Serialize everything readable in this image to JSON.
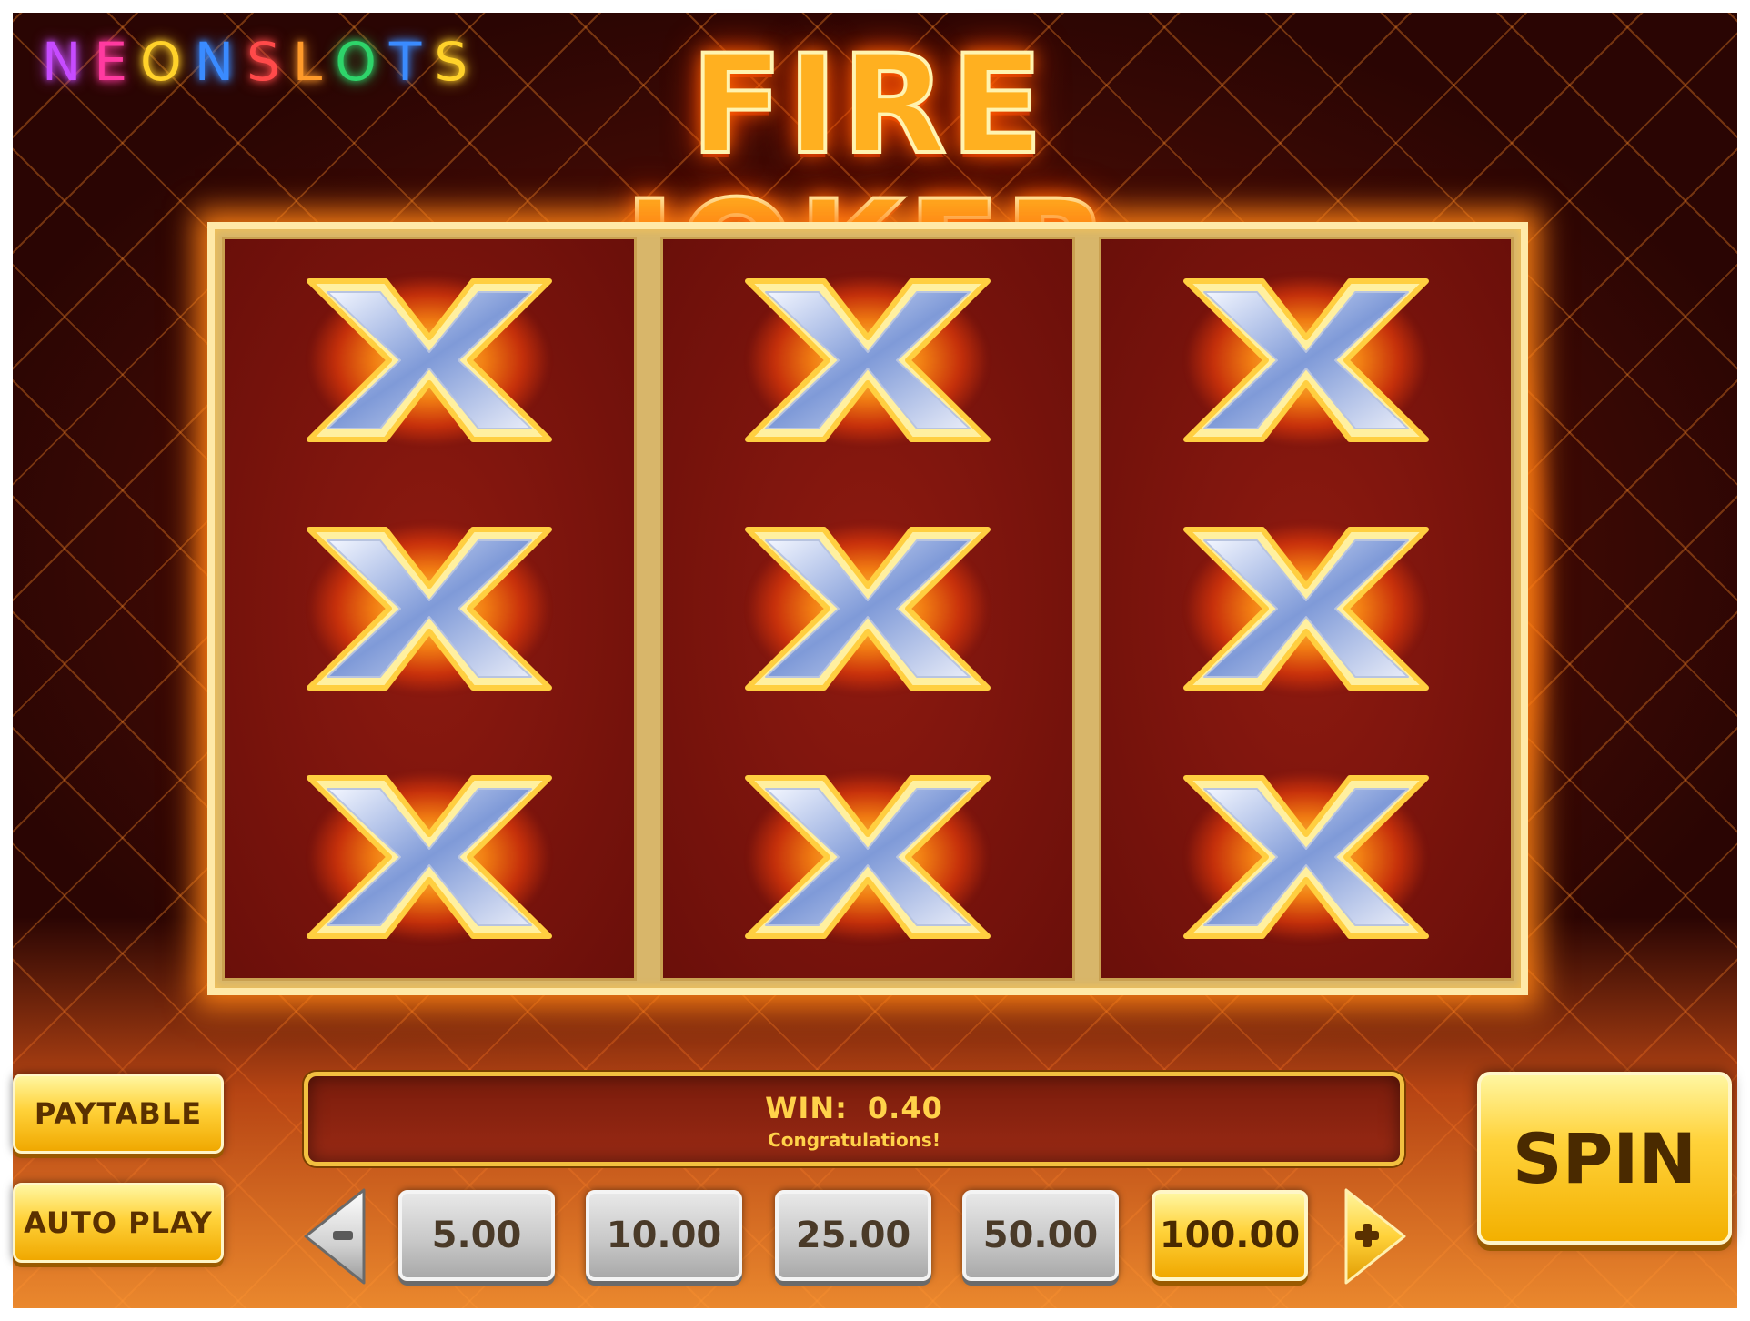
{
  "logo": {
    "letters": [
      {
        "char": "N",
        "color": "#c64bff"
      },
      {
        "char": "E",
        "color": "#ff3aa0"
      },
      {
        "char": "O",
        "color": "#ffd22a"
      },
      {
        "char": "N",
        "color": "#3a8bff"
      },
      {
        "char": "S",
        "color": "#ff4a4a"
      },
      {
        "char": "L",
        "color": "#ff9a2a"
      },
      {
        "char": "O",
        "color": "#2ed46a"
      },
      {
        "char": "T",
        "color": "#3a8bff"
      },
      {
        "char": "S",
        "color": "#ffd22a"
      }
    ]
  },
  "game": {
    "title": "FIRE JOKER"
  },
  "reels": {
    "symbol_name": "x-icon",
    "grid": [
      [
        "x",
        "x",
        "x"
      ],
      [
        "x",
        "x",
        "x"
      ],
      [
        "x",
        "x",
        "x"
      ]
    ]
  },
  "controls": {
    "paytable_label": "PAYTABLE",
    "autoplay_label": "AUTO PLAY",
    "spin_label": "SPIN",
    "decrease_icon": "minus-arrow-icon",
    "increase_icon": "plus-arrow-icon"
  },
  "win": {
    "label": "WIN:",
    "amount": "0.40",
    "message": "Congratulations!"
  },
  "bets": {
    "options": [
      "5.00",
      "10.00",
      "25.00",
      "50.00",
      "100.00"
    ],
    "selected": "100.00"
  },
  "colors": {
    "gold": "#ffd23a",
    "background": "#4a0d05",
    "win_text": "#ffd24a"
  }
}
